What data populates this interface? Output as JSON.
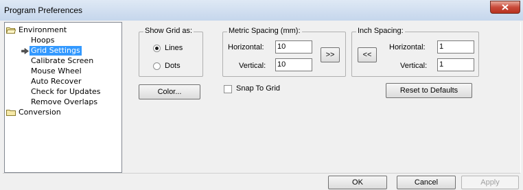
{
  "window": {
    "title": "Program Preferences"
  },
  "tree": {
    "items": [
      {
        "label": "Environment",
        "type": "folder-open"
      },
      {
        "label": "Hoops",
        "type": "child"
      },
      {
        "label": "Grid Settings",
        "type": "child-selected"
      },
      {
        "label": "Calibrate Screen",
        "type": "child"
      },
      {
        "label": "Mouse Wheel",
        "type": "child"
      },
      {
        "label": "Auto Recover",
        "type": "child"
      },
      {
        "label": "Check for Updates",
        "type": "child"
      },
      {
        "label": "Remove Overlaps",
        "type": "child"
      },
      {
        "label": "Conversion",
        "type": "folder-closed"
      }
    ]
  },
  "grid": {
    "show_grid": {
      "title": "Show Grid as:",
      "options": [
        "Lines",
        "Dots"
      ],
      "selected": "Lines"
    },
    "metric": {
      "title": "Metric Spacing (mm):",
      "horizontal_label": "Horizontal:",
      "horizontal_value": "10",
      "vertical_label": "Vertical:",
      "vertical_value": "10",
      "to_inch_button": ">>"
    },
    "inch": {
      "title": "Inch Spacing:",
      "horizontal_label": "Horizontal:",
      "horizontal_value": "1",
      "vertical_label": "Vertical:",
      "vertical_value": "1",
      "to_metric_button": "<<"
    },
    "color_button": "Color...",
    "snap_to_grid": {
      "label": "Snap To Grid",
      "checked": false
    },
    "reset_button": "Reset to Defaults"
  },
  "footer": {
    "ok": "OK",
    "cancel": "Cancel",
    "apply": "Apply"
  },
  "colors": {
    "selection": "#3399ff",
    "close_button": "#c94b3b",
    "titlebar": "#dfe9f5"
  }
}
